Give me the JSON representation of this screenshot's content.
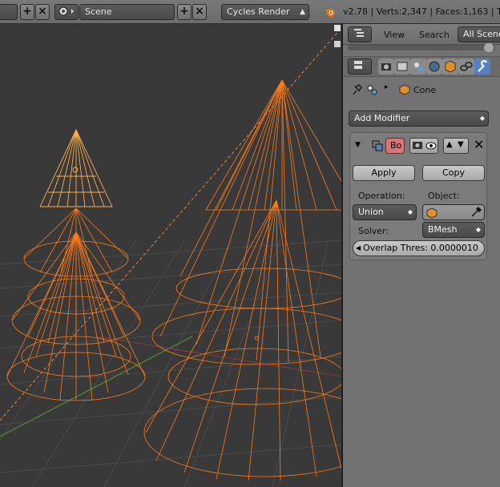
{
  "topbar": {
    "scene_name": "Scene",
    "render_engine": "Cycles Render",
    "status": "v2.78 | Verts:2,347 | Faces:1,163 | Tr"
  },
  "props_header": {
    "view_label": "View",
    "search_label": "Search",
    "scenes_label": "All Scene"
  },
  "breadcrumb": {
    "object_name": "Cone"
  },
  "add_modifier_label": "Add Modifier",
  "modifier": {
    "name": "Bo",
    "apply_label": "Apply",
    "copy_label": "Copy",
    "operation_label": "Operation:",
    "operation_value": "Union",
    "object_label": "Object:",
    "solver_label": "Solver:",
    "solver_value": "BMesh",
    "overlap_label": "Overlap Thres: 0.0000010"
  },
  "colors": {
    "wire_selected": "#ff7a1a",
    "wire_active": "#ffad4d",
    "panel_bg": "#727272"
  }
}
